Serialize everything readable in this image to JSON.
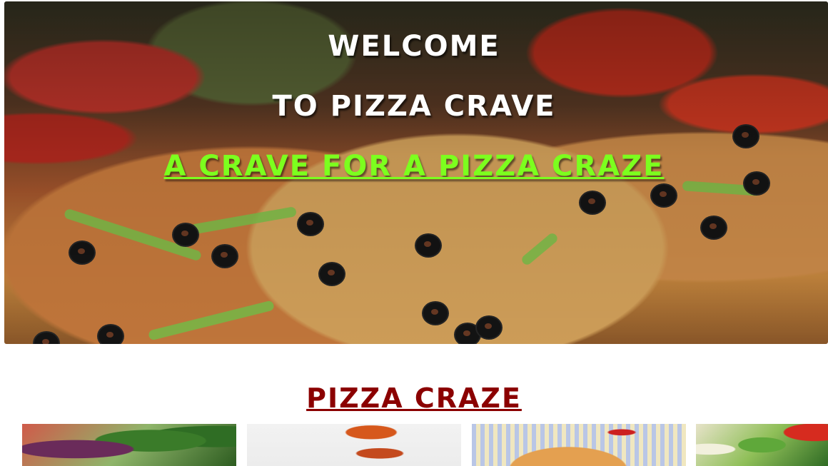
{
  "hero": {
    "welcome": "WELCOME",
    "title": "TO PIZZA CRAVE",
    "tagline": "A CRAVE FOR A PIZZA CRAZE",
    "image": "pizza-hero-image"
  },
  "section": {
    "title": "PIZZA CRAZE"
  },
  "cards": [
    {
      "image": "salad-vegetables-image"
    },
    {
      "image": "pizza-slice-image"
    },
    {
      "image": "pizza-on-tablecloth-image"
    },
    {
      "image": "fresh-ingredients-image"
    }
  ],
  "colors": {
    "tagline": "#7cff1e",
    "section_title": "#8b0000",
    "hero_text": "#ffffff"
  }
}
